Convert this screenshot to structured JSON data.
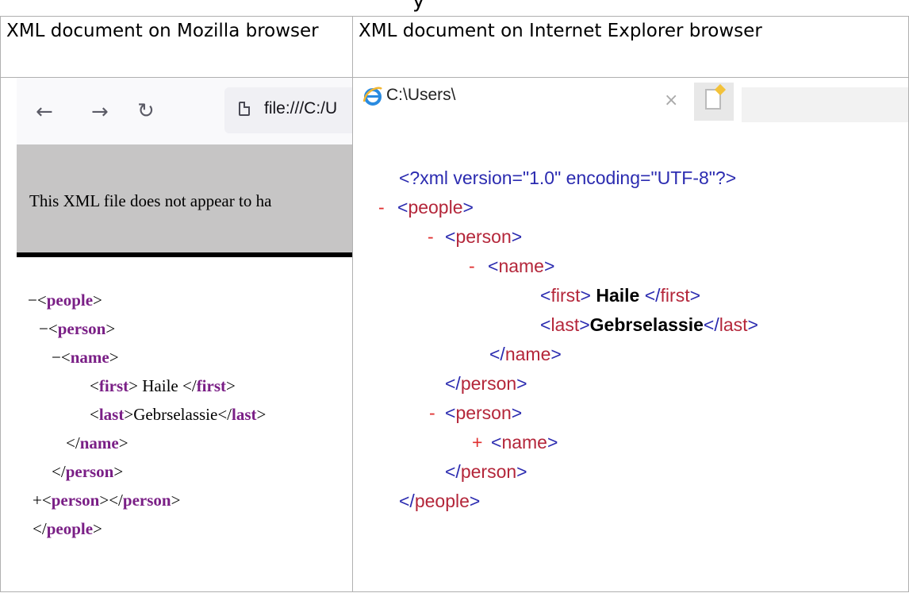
{
  "table": {
    "header_left": "XML document on Mozilla browser",
    "header_right": "XML document on  Internet Explorer browser"
  },
  "firefox": {
    "back_icon": "arrow-left-icon",
    "forward_icon": "arrow-right-icon",
    "reload_icon": "reload-icon",
    "url": "file:///C:/U",
    "banner_text": "This XML file does not appear to ha",
    "tag_color": "#7a1f86",
    "tree": {
      "l1_marker": "−",
      "l1_tag": "people",
      "l2_marker": "−",
      "l2_tag": "person",
      "l3_marker": "−",
      "l3_tag": "name",
      "first_tag": "first",
      "first_value": " Haile ",
      "last_tag": "last",
      "last_value": "Gebrselassie",
      "close_name": "name",
      "close_person": "person",
      "l2b_marker": "+",
      "l2b_tag": "person",
      "close_people": "people"
    }
  },
  "ie": {
    "logo_icon": "internet-explorer-icon",
    "path": "C:\\Users\\",
    "close_glyph": "×",
    "bracket_color": "#2b2bb0",
    "tagname_color": "#b4263a",
    "marker_color": "#e03030",
    "tree": {
      "declaration": "<?xml version=\"1.0\" encoding=\"UTF-8\"?>",
      "minus": "-",
      "plus": "+",
      "people": "people",
      "person": "person",
      "name": "name",
      "first": "first",
      "first_value": "Haile",
      "last": "last",
      "last_value": "Gebrselassie"
    }
  }
}
